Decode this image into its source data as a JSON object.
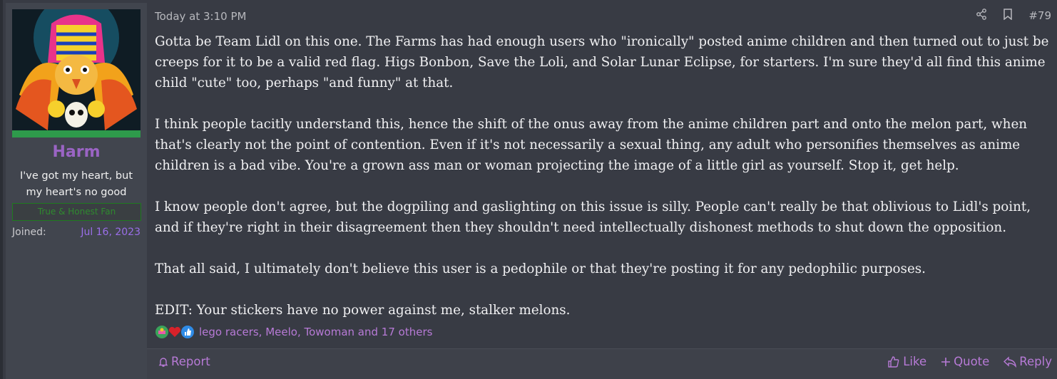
{
  "user": {
    "name": "Harm",
    "title_line1": "I've got my heart, but",
    "title_line2": "my heart's no good",
    "banner": "True & Honest Fan",
    "joined_label": "Joined:",
    "joined_value": "Jul 16, 2023"
  },
  "post": {
    "date": "Today at 3:10 PM",
    "number": "#79",
    "paragraphs": [
      "Gotta be Team Lidl on this one. The Farms has had enough users who \"ironically\" posted anime children and then turned out to just be creeps for it to be a valid red flag. Higs Bonbon, Save the Loli, and Solar Lunar Eclipse, for starters. I'm sure they'd all find this anime child \"cute\" too, perhaps \"and funny\" at that.",
      "I think people tacitly understand this, hence the shift of the onus away from the anime children part and onto the melon part, when that's clearly not the point of contention. Even if it's not necessarily a sexual thing, any adult who personifies themselves as anime children is a bad vibe. You're a grown ass man or woman projecting the image of a little girl as yourself. Stop it, get help.",
      "I know people don't agree, but the dogpiling and gaslighting on this issue is silly. People can't really be that oblivious to Lidl's point, and if they're right in their disagreement then they shouldn't need intellectually dishonest methods to shut down the opposition.",
      "That all said, I ultimately don't believe this user is a pedophile or that they're posting it for any pedophilic purposes.",
      "EDIT: Your stickers have no power against me, stalker melons."
    ],
    "reactions_text": "lego racers, Meelo, Towoman and 17 others"
  },
  "footer": {
    "report": "Report",
    "like": "Like",
    "quote": "Quote",
    "reply": "Reply"
  },
  "colors": {
    "accent": "#b77ad6",
    "username": "#9a64c4",
    "joined_date": "#9a6ee8",
    "banner": "#2f8a2f"
  }
}
